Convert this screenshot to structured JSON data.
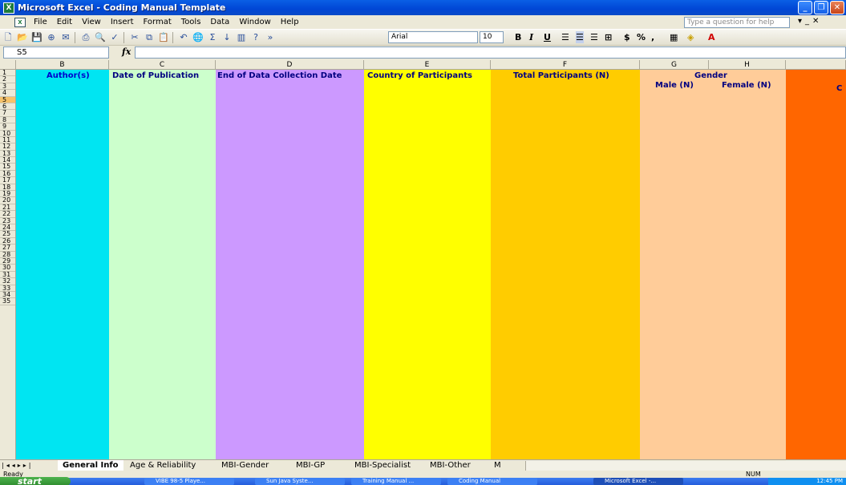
{
  "window": {
    "title": "Microsoft Excel - Coding Manual Template",
    "app_icon": "excel-icon"
  },
  "menu": {
    "items": [
      "File",
      "Edit",
      "View",
      "Insert",
      "Format",
      "Tools",
      "Data",
      "Window",
      "Help"
    ],
    "help_placeholder": "Type a question for help"
  },
  "toolbar": {
    "font": "Arial",
    "size": "10"
  },
  "formula": {
    "cell_ref": "S5",
    "fx": "fx"
  },
  "columns": {
    "letters": [
      "B",
      "C",
      "D",
      "E",
      "F",
      "G",
      "H"
    ],
    "headers": {
      "b": "Author(s)",
      "c": "Date of Publication",
      "d": "End of Data Collection Date",
      "e": "Country of Participants",
      "f": "Total Participants (N)",
      "g": "Gender",
      "g_male": "Male (N)",
      "h_female": "Female (N)",
      "i_partial": "C"
    },
    "colors": {
      "b": "#00E5F2",
      "c": "#CCFFCC",
      "d": "#CC99FF",
      "e": "#FFFF00",
      "f": "#FFCC00",
      "gh": "#FFCC99",
      "i": "#FF6600"
    }
  },
  "rows": [
    "1",
    "2",
    "3",
    "4",
    "5",
    "6",
    "7",
    "8",
    "9",
    "10",
    "11",
    "12",
    "13",
    "14",
    "15",
    "16",
    "17",
    "18",
    "19",
    "20",
    "21",
    "22",
    "23",
    "24",
    "25",
    "26",
    "27",
    "28",
    "29",
    "30",
    "31",
    "32",
    "33",
    "34",
    "35"
  ],
  "sheets": {
    "tabs": [
      "General Info",
      "Age & Reliability",
      "MBI-Gender",
      "MBI-GP",
      "MBI-Specialist",
      "MBI-Other",
      "M"
    ],
    "active": "General Info"
  },
  "status": {
    "left": "Ready",
    "num": "NUM"
  },
  "taskbar": {
    "start": "start",
    "tasks": [
      "VIBE 98-5 Playe...",
      "Sun Java Syste...",
      "Training Manual ...",
      "Coding Manual",
      "Microsoft Excel -..."
    ],
    "clock": "12:45 PM"
  }
}
